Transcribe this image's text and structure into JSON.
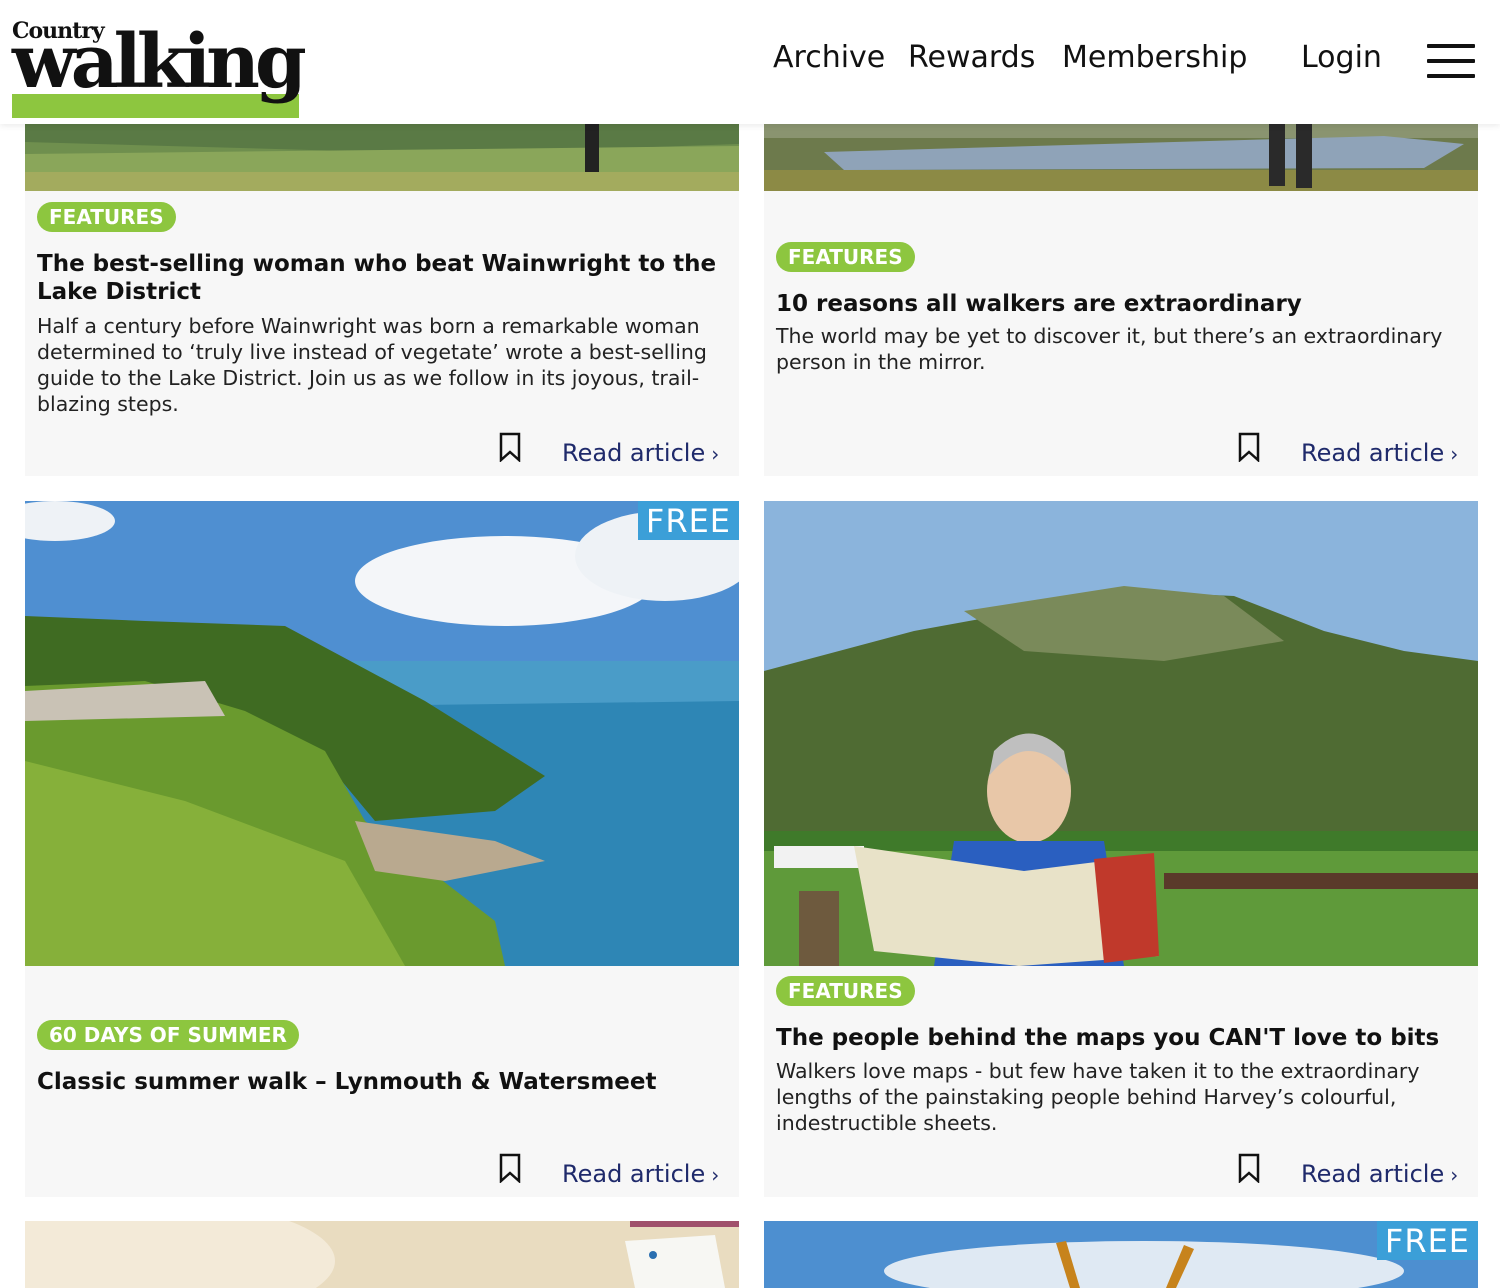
{
  "header": {
    "logo_small": "Country",
    "logo_large": "walking",
    "nav": [
      "Archive",
      "Rewards",
      "Membership"
    ],
    "login": "Login",
    "menu_icon": "hamburger-icon"
  },
  "cards": [
    {
      "tag": "FEATURES",
      "title": "The best-selling woman who beat Wainwright to the Lake District",
      "description": "Half a century before Wainwright was born a remarkable woman determined to ‘truly live instead of vegetate’ wrote a best-selling guide to the Lake District. Join us as we follow in its joyous, trail-blazing steps.",
      "read": "Read article"
    },
    {
      "tag": "FEATURES",
      "title": "10 reasons all walkers are extraordinary",
      "description": "The world may be yet to discover it, but there’s an extraordinary person in the mirror.",
      "read": "Read article"
    },
    {
      "badge": "FREE",
      "tag": "60 DAYS OF SUMMER",
      "title": "Classic summer walk – Lynmouth & Watersmeet",
      "description": "",
      "read": "Read article"
    },
    {
      "tag": "FEATURES",
      "title": "The people behind the maps you CAN'T love to bits",
      "description": "Walkers love maps - but few have taken it to the extraordinary lengths of the painstaking people behind Harvey’s colourful, indestructible sheets.",
      "read": "Read article"
    },
    {
      "badge": ""
    },
    {
      "badge": "FREE"
    }
  ],
  "colors": {
    "accent_green": "#8dc63f",
    "free_blue": "#3b9fd8",
    "link_navy": "#1f2a6b"
  }
}
